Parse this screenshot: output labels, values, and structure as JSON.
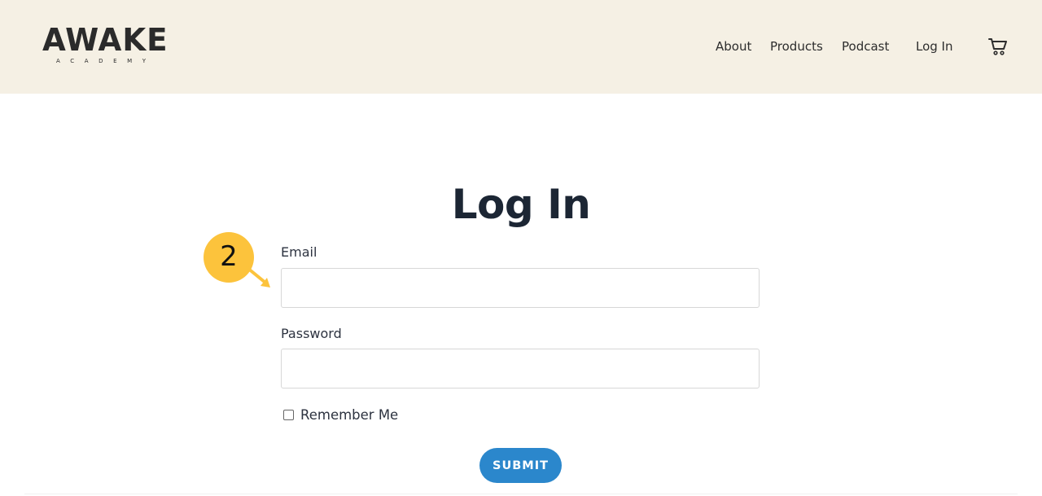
{
  "header": {
    "logo": {
      "main": "AWAKE",
      "sub": "ACADEMY"
    },
    "nav": [
      {
        "label": "About"
      },
      {
        "label": "Products"
      },
      {
        "label": "Podcast"
      },
      {
        "label": "Log In"
      }
    ],
    "cart_icon": "shopping-cart-icon"
  },
  "main": {
    "title": "Log In",
    "annotation_badge": "2",
    "email": {
      "label": "Email",
      "value": "",
      "placeholder": ""
    },
    "password": {
      "label": "Password",
      "value": "",
      "placeholder": ""
    },
    "remember": {
      "label": "Remember Me",
      "checked": false
    },
    "submit_label": "SUBMIT"
  },
  "colors": {
    "header_bg": "#f5f0e4",
    "accent": "#2b87cc",
    "badge": "#fcc33c",
    "title": "#1c2634"
  }
}
